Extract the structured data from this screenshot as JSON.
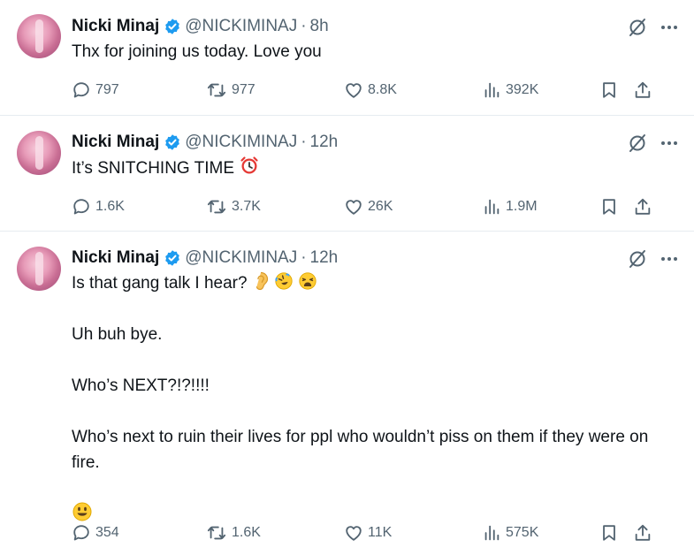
{
  "colors": {
    "verified": "#1d9bf0",
    "muted": "#536471",
    "text": "#0f1419"
  },
  "icons": {
    "verified": "verified-badge-icon",
    "grok": "grok-icon",
    "more": "more-icon",
    "reply": "reply-icon",
    "retweet": "retweet-icon",
    "like": "like-icon",
    "views": "views-icon",
    "bookmark": "bookmark-icon",
    "share": "share-icon"
  },
  "tweets": [
    {
      "name": "Nicki Minaj",
      "handle": "@NICKIMINAJ",
      "sep": "·",
      "time": "8h",
      "text": "Thx for joining us today. Love you",
      "replies": "797",
      "retweets": "977",
      "likes": "8.8K",
      "views": "392K"
    },
    {
      "name": "Nicki Minaj",
      "handle": "@NICKIMINAJ",
      "sep": "·",
      "time": "12h",
      "text": "It’s SNITCHING TIME",
      "replies": "1.6K",
      "retweets": "3.7K",
      "likes": "26K",
      "views": "1.9M"
    },
    {
      "name": "Nicki Minaj",
      "handle": "@NICKIMINAJ",
      "sep": "·",
      "time": "12h",
      "p1": "Is that gang talk I hear?",
      "p2": "Uh buh bye.",
      "p3": "Who’s NEXT?!?!!!!",
      "p4": "Who’s next to ruin their lives for ppl who wouldn’t piss on them if they were on fire.",
      "replies": "354",
      "retweets": "1.6K",
      "likes": "11K",
      "views": "575K"
    }
  ]
}
